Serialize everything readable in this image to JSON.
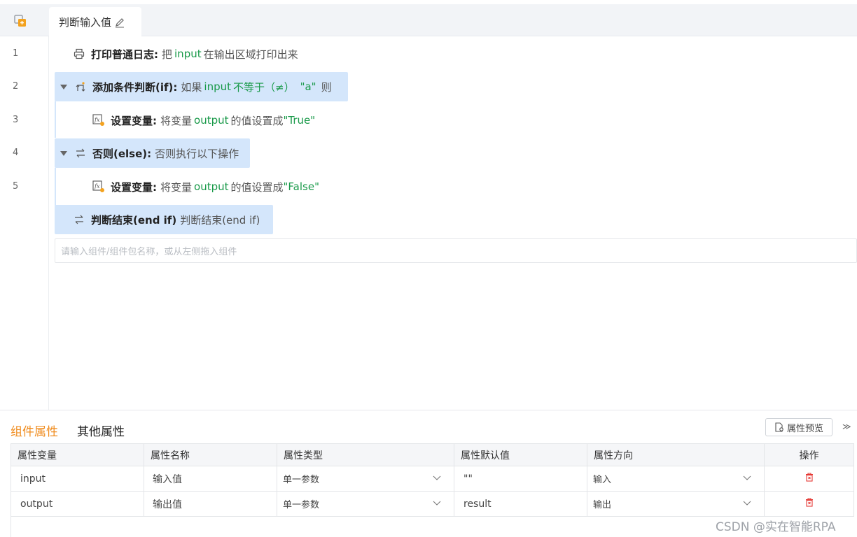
{
  "tab": {
    "title": "判断输入值"
  },
  "lines": [
    "1",
    "2",
    "3",
    "4",
    "5"
  ],
  "rows": [
    {
      "label": "打印普通日志:",
      "parts": [
        "把",
        "input",
        "在输出区域打印出来"
      ]
    },
    {
      "label": "添加条件判断(if):",
      "parts": [
        "如果",
        "input",
        "不等于（≠）",
        "\"a\"",
        "则"
      ]
    },
    {
      "label": "设置变量:",
      "parts": [
        "将变量",
        "output",
        "的值设置成",
        "\"True\""
      ]
    },
    {
      "label": "否则(else):",
      "parts": [
        "否则执行以下操作"
      ]
    },
    {
      "label": "设置变量:",
      "parts": [
        "将变量",
        "output",
        "的值设置成",
        "\"False\""
      ]
    },
    {
      "label": "判断结束(end if)",
      "parts": [
        "判断结束(end if)"
      ]
    }
  ],
  "add_placeholder": "请输入组件/组件包名称，或从左侧拖入组件",
  "panel": {
    "tabs": [
      "组件属性",
      "其他属性"
    ],
    "preview_label": "属性预览",
    "collapse": "≫",
    "columns": [
      "属性变量",
      "属性名称",
      "属性类型",
      "属性默认值",
      "属性方向",
      "操作"
    ],
    "table": [
      {
        "var": "input",
        "name": "输入值",
        "type": "单一参数",
        "default": "\"\"",
        "direction": "输入"
      },
      {
        "var": "output",
        "name": "输出值",
        "type": "单一参数",
        "default": "result",
        "direction": "输出"
      }
    ]
  },
  "watermark": "CSDN @实在智能RPA",
  "colors": {
    "accent": "#f08c1e",
    "highlight": "#d4e6fb",
    "green": "#1a9a4a",
    "delete": "#e53935"
  }
}
